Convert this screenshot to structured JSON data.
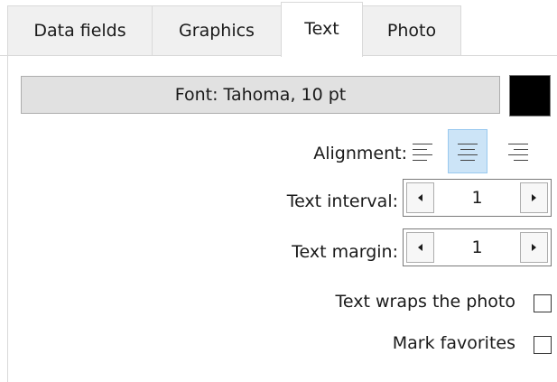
{
  "tabs": [
    {
      "label": "Data fields",
      "active": false
    },
    {
      "label": "Graphics",
      "active": false
    },
    {
      "label": "Text",
      "active": true
    },
    {
      "label": "Photo",
      "active": false
    }
  ],
  "text_panel": {
    "font_button_label": "Font: Tahoma, 10 pt",
    "text_color": "#000000",
    "alignment": {
      "label": "Alignment:",
      "options": [
        {
          "name": "left",
          "icon": "align-left-icon",
          "selected": false
        },
        {
          "name": "center",
          "icon": "align-center-icon",
          "selected": true
        },
        {
          "name": "right",
          "icon": "align-right-icon",
          "selected": false
        }
      ]
    },
    "text_interval": {
      "label": "Text interval:",
      "value": "1",
      "decrement_icon": "triangle-left-icon",
      "increment_icon": "triangle-right-icon"
    },
    "text_margin": {
      "label": "Text margin:",
      "value": "1",
      "decrement_icon": "triangle-left-icon",
      "increment_icon": "triangle-right-icon"
    },
    "wrap_photo": {
      "label": "Text wraps the photo",
      "checked": false
    },
    "mark_favorites": {
      "label": "Mark favorites",
      "checked": false
    }
  },
  "colors": {
    "tab_inactive_bg": "#f0f0f0",
    "button_bg": "#e1e1e1",
    "selected_bg": "#cce4f7",
    "selected_border": "#99c9ef"
  }
}
